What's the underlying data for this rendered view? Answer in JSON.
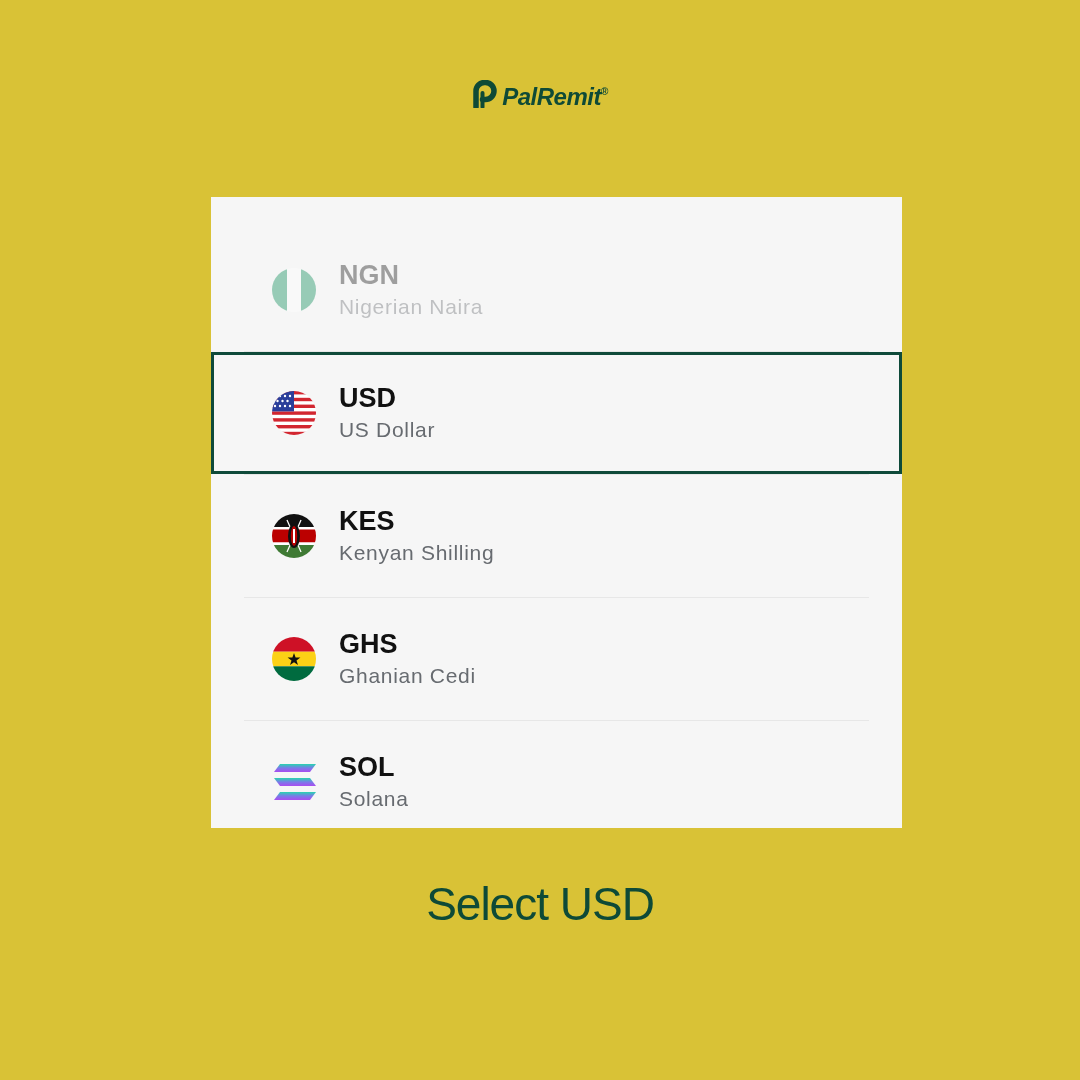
{
  "logo": {
    "wordmark": "PalRemit$^{®}$"
  },
  "currencies": [
    {
      "code": "NGN",
      "name": "Nigerian Naira",
      "selected": false,
      "dimmed": true
    },
    {
      "code": "USD",
      "name": "US Dollar",
      "selected": true,
      "dimmed": false
    },
    {
      "code": "KES",
      "name": "Kenyan Shilling",
      "selected": false,
      "dimmed": false
    },
    {
      "code": "GHS",
      "name": "Ghanian Cedi",
      "selected": false,
      "dimmed": false
    },
    {
      "code": "SOL",
      "name": "Solana",
      "selected": false,
      "dimmed": false
    }
  ],
  "caption": "Select USD"
}
